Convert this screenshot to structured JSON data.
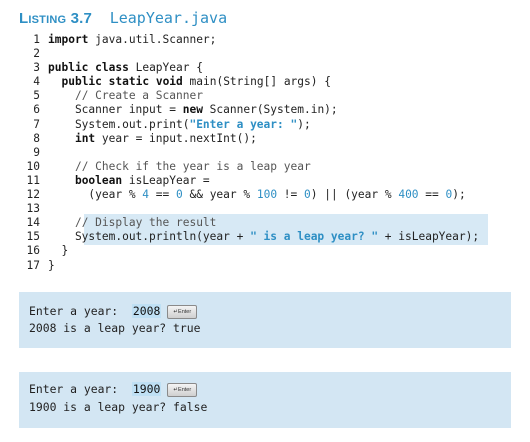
{
  "listing": {
    "label": "Listing 3.7",
    "filename": "LeapYear.java"
  },
  "code_lines": [
    {
      "num": "1",
      "text": "import java.util.Scanner;"
    },
    {
      "num": "2",
      "text": ""
    },
    {
      "num": "3",
      "text": "public class LeapYear {"
    },
    {
      "num": "4",
      "text": "  public static void main(String[] args) {"
    },
    {
      "num": "5",
      "text": "    // Create a Scanner"
    },
    {
      "num": "6",
      "text": "    Scanner input = new Scanner(System.in);"
    },
    {
      "num": "7",
      "text": "    System.out.print(\"Enter a year: \");"
    },
    {
      "num": "8",
      "text": "    int year = input.nextInt();"
    },
    {
      "num": "9",
      "text": ""
    },
    {
      "num": "10",
      "text": "    // Check if the year is a leap year"
    },
    {
      "num": "11",
      "text": "    boolean isLeapYear ="
    },
    {
      "num": "12",
      "text": "      (year % 4 == 0 && year % 100 != 0) || (year % 400 == 0);"
    },
    {
      "num": "13",
      "text": ""
    },
    {
      "num": "14",
      "text": "    // Display the result"
    },
    {
      "num": "15",
      "text": "    System.out.println(year + \" is a leap year? \" + isLeapYear);"
    },
    {
      "num": "16",
      "text": "  }"
    },
    {
      "num": "17",
      "text": "}"
    }
  ],
  "runs": [
    {
      "prompt": "Enter a year: ",
      "input": "2008",
      "enter_label": "↵Enter",
      "output": "2008 is a leap year? true"
    },
    {
      "prompt": "Enter a year: ",
      "input": "1900",
      "enter_label": "↵Enter",
      "output": "1900 is a leap year? false"
    }
  ],
  "colors": {
    "accent": "#2e8fc4",
    "highlight": "#d7e9f5",
    "console_bg": "#d3e6f3"
  }
}
